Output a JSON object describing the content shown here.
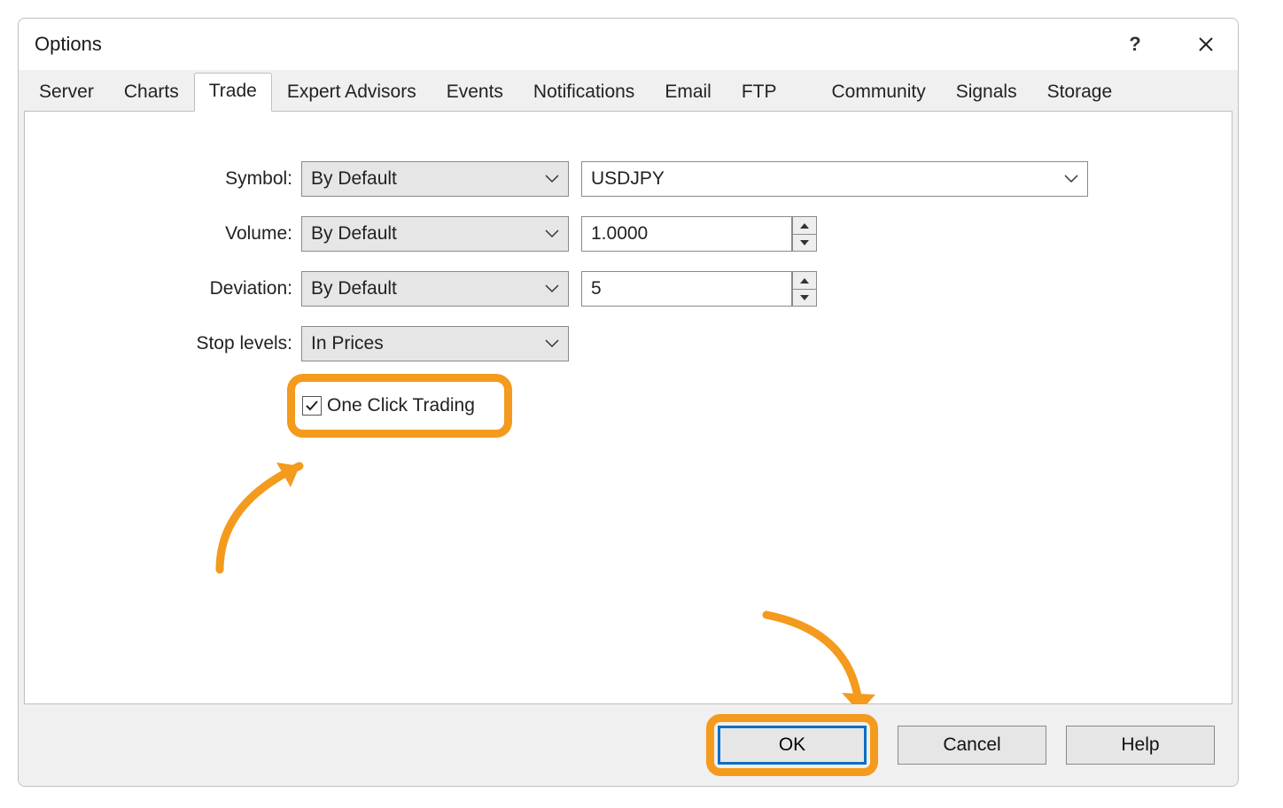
{
  "dialog": {
    "title": "Options",
    "help": "?",
    "close": "×"
  },
  "tabs": [
    {
      "label": "Server"
    },
    {
      "label": "Charts"
    },
    {
      "label": "Trade"
    },
    {
      "label": "Expert Advisors"
    },
    {
      "label": "Events"
    },
    {
      "label": "Notifications"
    },
    {
      "label": "Email"
    },
    {
      "label": "FTP"
    },
    {
      "label": "Community"
    },
    {
      "label": "Signals"
    },
    {
      "label": "Storage"
    }
  ],
  "active_tab_index": 2,
  "trade": {
    "symbol_label": "Symbol:",
    "symbol_mode": "By Default",
    "symbol_value": "USDJPY",
    "volume_label": "Volume:",
    "volume_mode": "By Default",
    "volume_value": "1.0000",
    "deviation_label": "Deviation:",
    "deviation_mode": "By Default",
    "deviation_value": "5",
    "stoplevels_label": "Stop levels:",
    "stoplevels_mode": "In Prices",
    "one_click_label": "One Click Trading",
    "one_click_checked": true
  },
  "footer": {
    "ok": "OK",
    "cancel": "Cancel",
    "help": "Help"
  },
  "highlight_color": "#f49a1c"
}
